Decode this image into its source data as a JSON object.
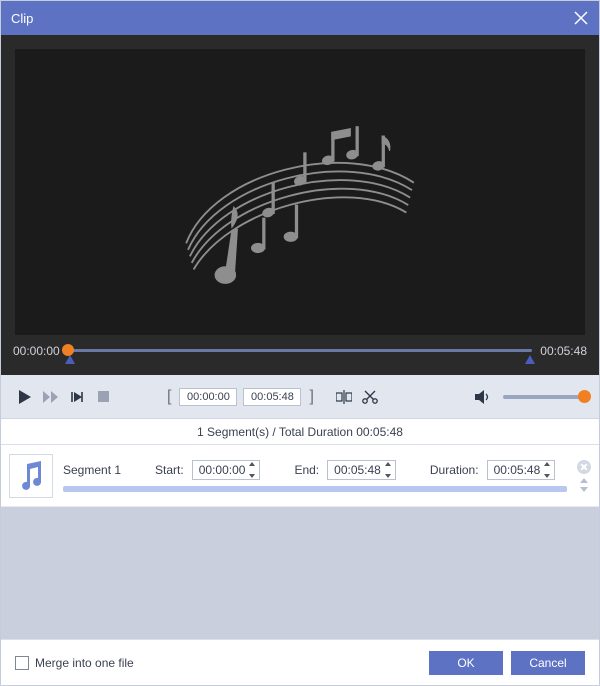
{
  "window": {
    "title": "Clip"
  },
  "timeline": {
    "current": "00:00:00",
    "total": "00:05:48"
  },
  "controls": {
    "range_start": "00:00:00",
    "range_end": "00:05:48"
  },
  "summary": {
    "text": "1 Segment(s) / Total Duration 00:05:48"
  },
  "segments": [
    {
      "name": "Segment 1",
      "start_label": "Start:",
      "start": "00:00:00",
      "end_label": "End:",
      "end": "00:05:48",
      "duration_label": "Duration:",
      "duration": "00:05:48"
    }
  ],
  "footer": {
    "merge_label": "Merge into one file",
    "ok": "OK",
    "cancel": "Cancel"
  }
}
